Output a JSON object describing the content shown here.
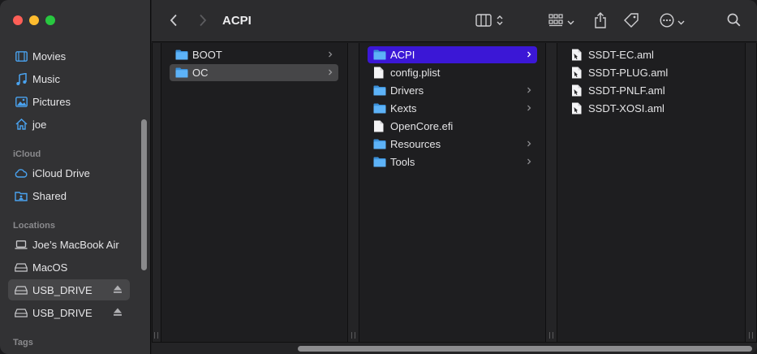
{
  "window": {
    "title": "ACPI"
  },
  "toolbar": {
    "title": "ACPI",
    "back_icon": "chevron-left-icon",
    "forward_icon": "chevron-right-icon",
    "view_icon": "column-view-icon",
    "group_icon": "grid-group-icon",
    "share_icon": "share-icon",
    "tag_icon": "tag-icon",
    "more_icon": "ellipsis-circle-icon",
    "search_icon": "search-icon"
  },
  "sidebar": {
    "favorites": [
      {
        "label": "Movies",
        "icon": "film-icon"
      },
      {
        "label": "Music",
        "icon": "music-note-icon"
      },
      {
        "label": "Pictures",
        "icon": "photo-icon"
      },
      {
        "label": "joe",
        "icon": "home-icon"
      }
    ],
    "icloud_header": "iCloud",
    "icloud": [
      {
        "label": "iCloud Drive",
        "icon": "cloud-icon"
      },
      {
        "label": "Shared",
        "icon": "shared-folder-icon"
      }
    ],
    "locations_header": "Locations",
    "locations": [
      {
        "label": "Joe’s MacBook Air",
        "icon": "laptop-icon"
      },
      {
        "label": "MacOS",
        "icon": "disk-icon"
      },
      {
        "label": "USB_DRIVE",
        "icon": "disk-icon",
        "eject": true,
        "selected": true
      },
      {
        "label": "USB_DRIVE",
        "icon": "disk-icon",
        "eject": true
      }
    ],
    "tags_header": "Tags"
  },
  "columns": [
    {
      "items": [
        {
          "label": "BOOT",
          "type": "folder",
          "has_children": true
        },
        {
          "label": "OC",
          "type": "folder",
          "has_children": true,
          "selected": "gray"
        }
      ]
    },
    {
      "items": [
        {
          "label": "ACPI",
          "type": "folder",
          "has_children": true,
          "selected": "blue"
        },
        {
          "label": "config.plist",
          "type": "file",
          "has_children": false
        },
        {
          "label": "Drivers",
          "type": "folder",
          "has_children": true
        },
        {
          "label": "Kexts",
          "type": "folder",
          "has_children": true
        },
        {
          "label": "OpenCore.efi",
          "type": "file",
          "has_children": false
        },
        {
          "label": "Resources",
          "type": "folder",
          "has_children": true
        },
        {
          "label": "Tools",
          "type": "folder",
          "has_children": true
        }
      ]
    },
    {
      "items": [
        {
          "label": "SSDT-EC.aml",
          "type": "aml"
        },
        {
          "label": "SSDT-PLUG.aml",
          "type": "aml"
        },
        {
          "label": "SSDT-PNLF.aml",
          "type": "aml"
        },
        {
          "label": "SSDT-XOSI.aml",
          "type": "aml"
        }
      ]
    }
  ],
  "colors": {
    "accent": "#3b17d6",
    "folder": "#4aa8f5"
  }
}
